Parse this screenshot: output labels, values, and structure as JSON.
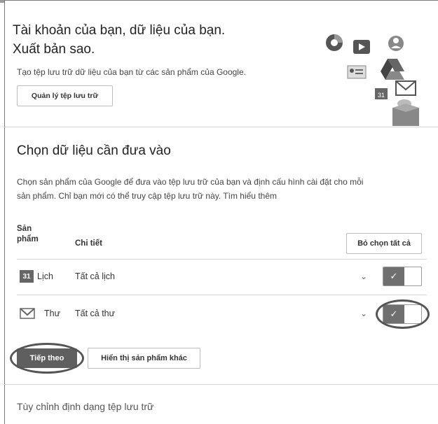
{
  "hero": {
    "title_line1": "Tài khoản của bạn, dữ liệu của bạn.",
    "title_line2": "Xuất bản sao.",
    "description": "Tạo tệp lưu trữ dữ liệu của bạn từ các sản phẩm của Google.",
    "manage_button": "Quản lý tệp lưu trữ"
  },
  "select_section": {
    "title": "Chọn dữ liệu cần đưa vào",
    "description_line1": "Chọn sản phẩm của Google để đưa vào tệp lưu trữ của bạn và định cấu hình cài đặt cho mỗi",
    "description_line2": "sản phẩm. Chỉ bạn mới có thể truy cập tệp lưu trữ này. Tìm hiểu thêm"
  },
  "table": {
    "header_product_line1": "Sản",
    "header_product_line2": "phẩm",
    "header_details": "Chi tiết",
    "deselect_all": "Bỏ chọn tất cả",
    "rows": [
      {
        "product": "Lịch",
        "details": "Tất cả lịch",
        "icon": "calendar-icon",
        "icon_text": "31",
        "enabled": true
      },
      {
        "product": "Thư",
        "details": "Tất cả thư",
        "icon": "gmail-icon",
        "enabled": true
      }
    ]
  },
  "actions": {
    "next": "Tiếp theo",
    "show_more": "Hiển thị sản phẩm khác"
  },
  "footer": {
    "customize_format": "Tùy chỉnh định dạng tệp lưu trữ"
  },
  "decor": {
    "calendar_badge": "31"
  },
  "colors": {
    "toggle_on": "#6f6f6f",
    "primary_button": "#5f5f5f"
  }
}
